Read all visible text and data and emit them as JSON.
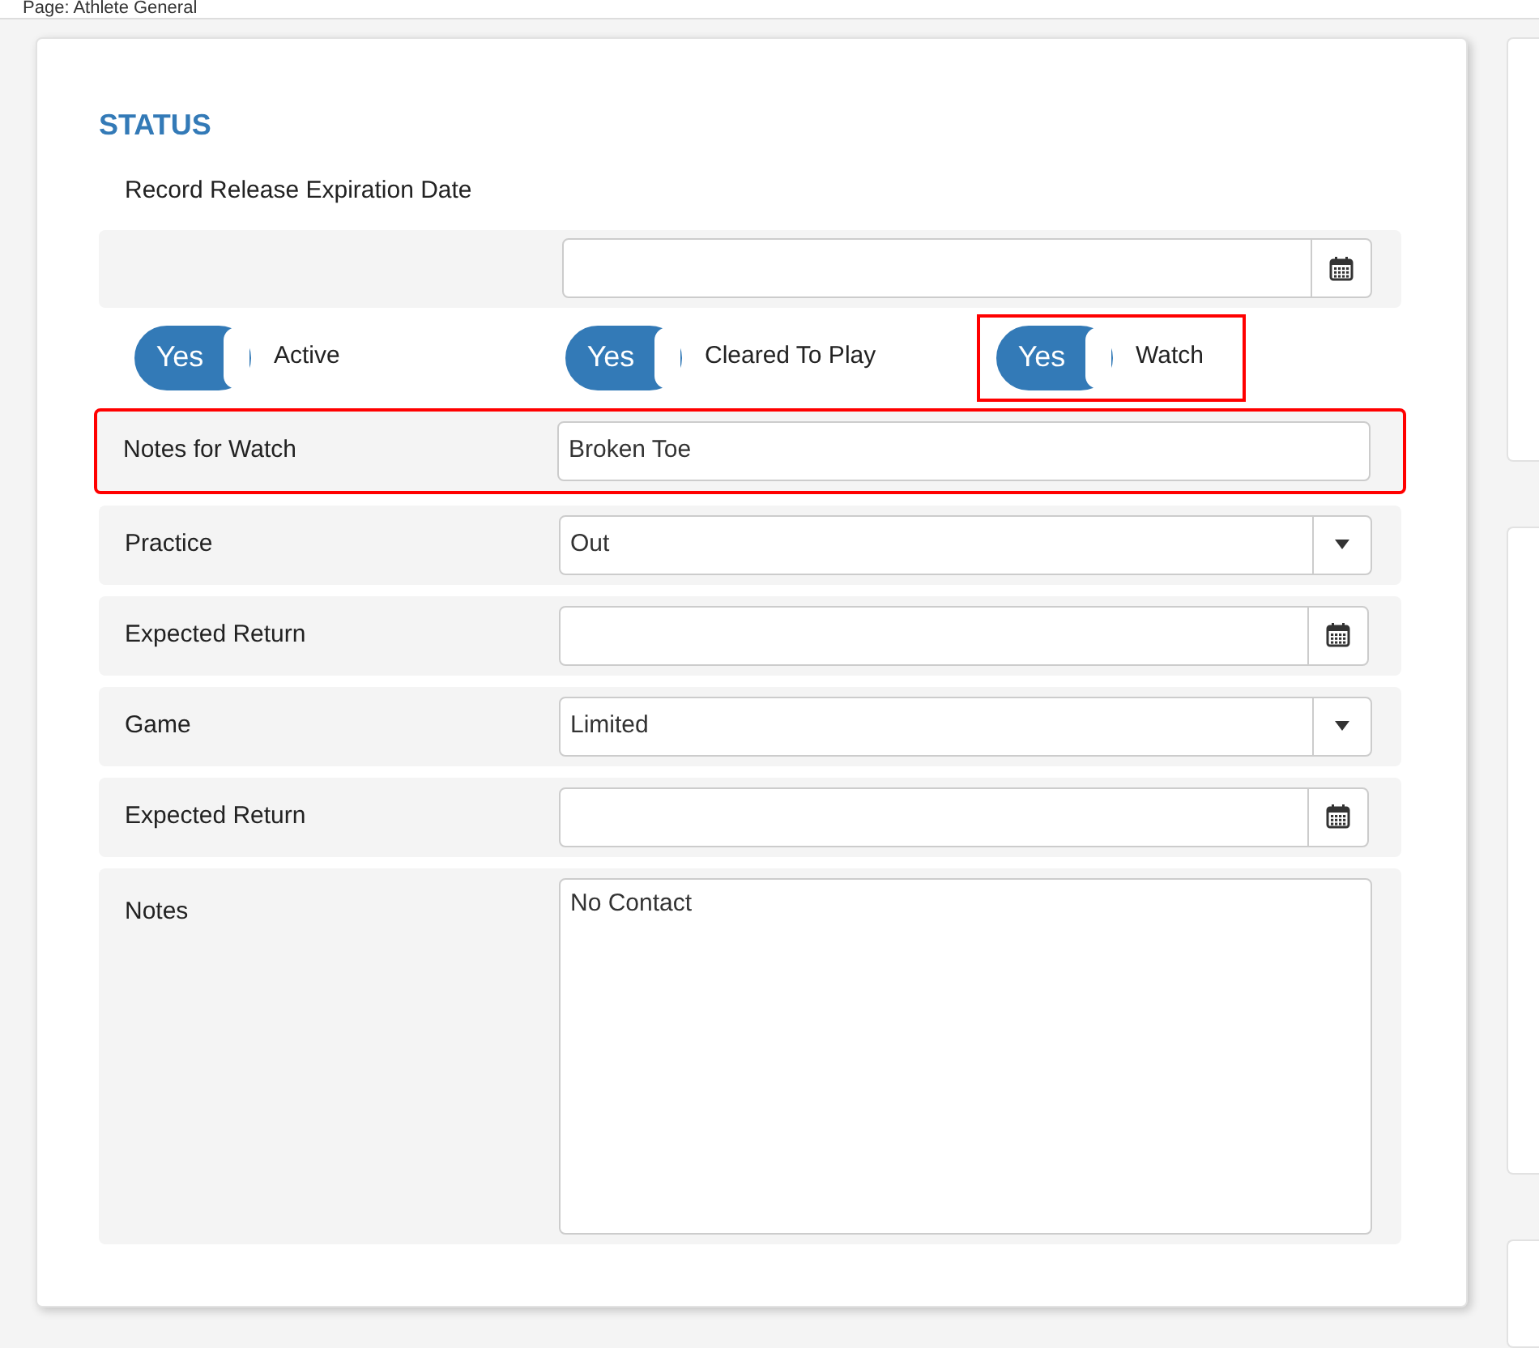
{
  "page_label": "Page: Athlete General",
  "section": {
    "title": "STATUS",
    "date_label": "Record Release Expiration Date",
    "toggles": [
      {
        "label": "Active",
        "text": "Yes",
        "on": true,
        "highlighted": false
      },
      {
        "label": "Cleared To Play",
        "text": "Yes",
        "on": true,
        "highlighted": false
      },
      {
        "label": "Watch",
        "text": "Yes",
        "on": true,
        "highlighted": true
      }
    ],
    "rows": [
      {
        "kind": "text",
        "label": "Notes for Watch",
        "value": "Broken Toe",
        "highlighted": true
      },
      {
        "kind": "select",
        "label": "Practice",
        "value": "Out",
        "highlighted": false
      },
      {
        "kind": "date",
        "label": "Expected Return",
        "highlighted": false
      },
      {
        "kind": "select",
        "label": "Game",
        "value": "Limited",
        "highlighted": false
      },
      {
        "kind": "date",
        "label": "Expected Return",
        "highlighted": false
      },
      {
        "kind": "textarea",
        "label": "Notes",
        "value": "No Contact",
        "highlighted": false
      }
    ]
  }
}
